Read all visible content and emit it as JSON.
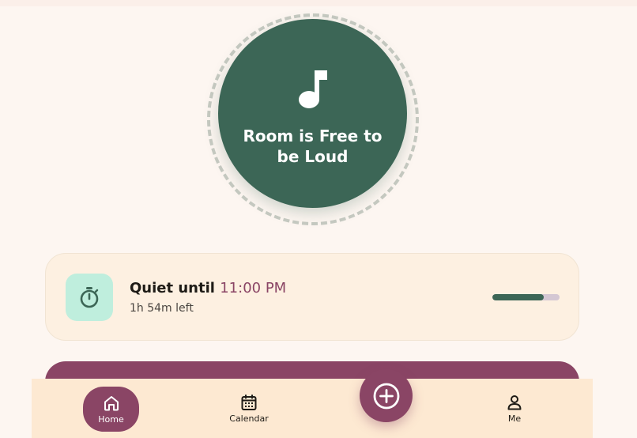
{
  "status": {
    "title": "Room is Free to be Loud",
    "icon": "music-note-icon"
  },
  "quiet_card": {
    "title_prefix": "Quiet until",
    "time": "11:00 PM",
    "remaining": "1h 54m left",
    "progress_fraction": 0.76,
    "icon": "timer-icon"
  },
  "nav": {
    "home_label": "Home",
    "calendar_label": "Calendar",
    "me_label": "Me",
    "add_icon": "plus-circle-icon"
  },
  "colors": {
    "primary_green": "#3c6656",
    "accent_purple": "#8a4565",
    "mint": "#bfeedd",
    "background": "#fdf6f1",
    "card": "#fdf0e1"
  }
}
